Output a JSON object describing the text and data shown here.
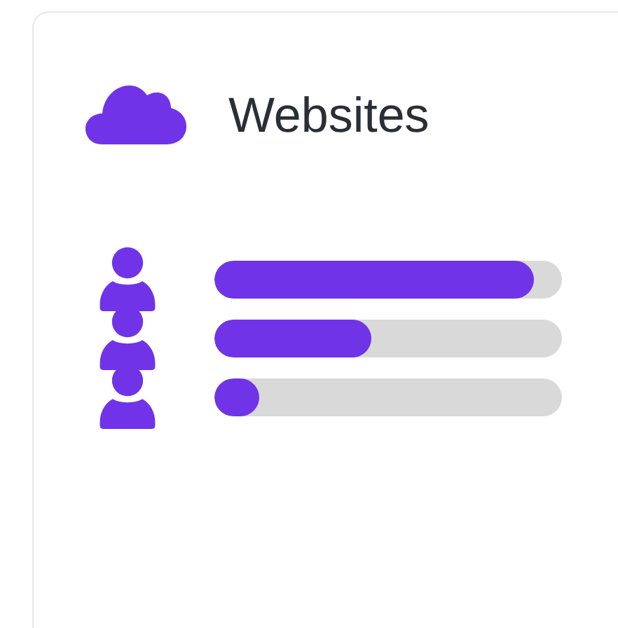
{
  "title": "Websites",
  "rows": [
    {
      "level": 0.92
    },
    {
      "level": 0.45
    },
    {
      "level": 0.13
    }
  ]
}
